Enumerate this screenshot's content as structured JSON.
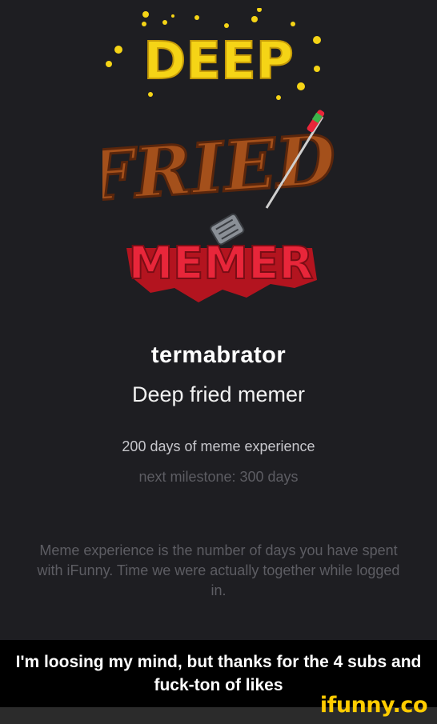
{
  "badge": {
    "word_top": "DEEP",
    "word_middle": "FRIED",
    "word_bottom": "MEMER"
  },
  "profile": {
    "username": "termabrator",
    "rank": "Deep fried memer",
    "experience": "200 days of meme experience",
    "next_milestone": "next milestone: 300 days",
    "explanation": "Meme experience is the number of days you have spent with iFunny. Time we were actually together while logged in."
  },
  "caption": {
    "text": "I'm loosing my mind, but thanks for the 4 subs and fuck-ton of likes"
  },
  "watermark": {
    "text": "ifunny.co"
  },
  "colors": {
    "background": "#1e1e22",
    "deep_yellow": "#f5d416",
    "fried_brown": "#a4501b",
    "memer_red": "#e8263a",
    "watermark": "#ffcc00"
  },
  "icons": [
    "spatula-icon",
    "skewer-icon"
  ]
}
